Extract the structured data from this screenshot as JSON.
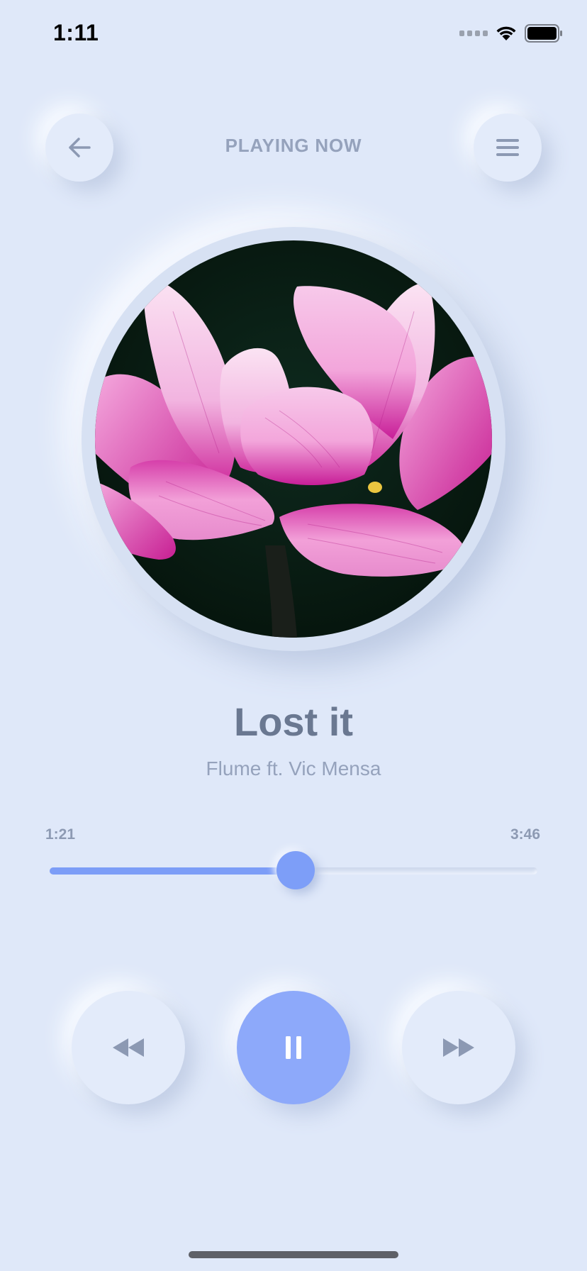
{
  "status_bar": {
    "time": "1:11",
    "signal_icon": "cellular-signal-icon",
    "wifi_icon": "wifi-icon",
    "battery_icon": "battery-icon"
  },
  "header": {
    "title": "PLAYING NOW",
    "back_icon": "arrow-left-icon",
    "menu_icon": "hamburger-menu-icon"
  },
  "album_art": {
    "subject": "pink-lotus-flower"
  },
  "song": {
    "title": "Lost it",
    "artist": "Flume ft. Vic Mensa"
  },
  "progress": {
    "current_time": "1:21",
    "total_time": "3:46",
    "fraction": 0.505
  },
  "controls": {
    "previous_icon": "rewind-icon",
    "play_pause_icon": "pause-icon",
    "next_icon": "fast-forward-icon"
  },
  "colors": {
    "background": "#DFE8F9",
    "accent": "#7D9EF8",
    "text_primary": "#6A7891",
    "text_secondary": "#95A2BC"
  }
}
